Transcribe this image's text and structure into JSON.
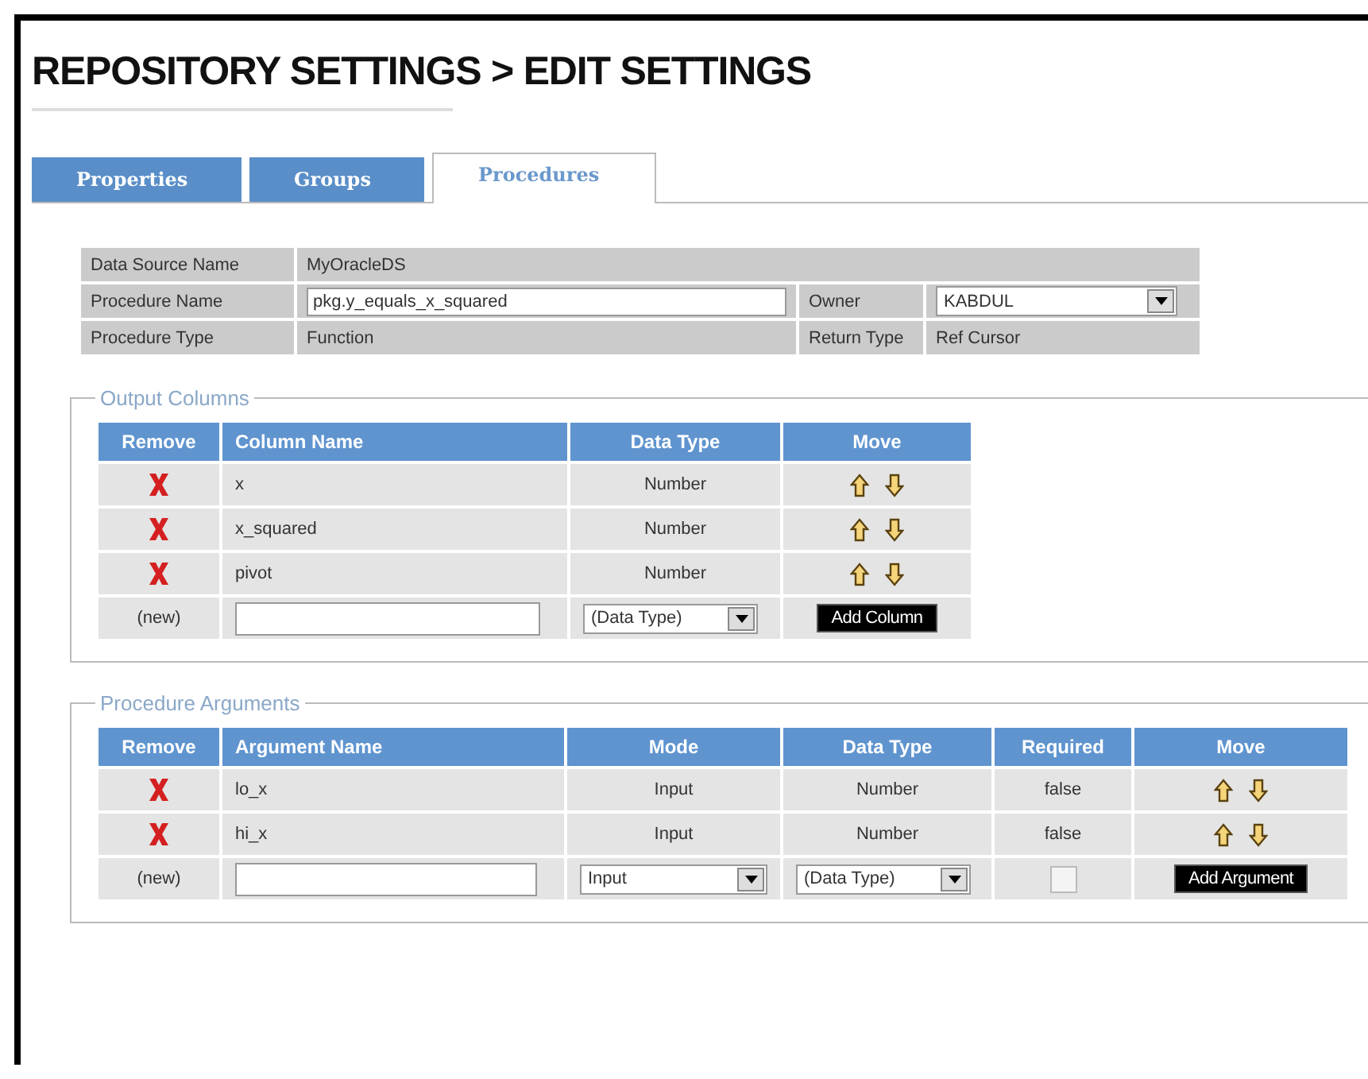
{
  "title": "REPOSITORY SETTINGS > EDIT SETTINGS",
  "tabs": [
    {
      "label": "Properties",
      "selected": false
    },
    {
      "label": "Groups",
      "selected": false
    },
    {
      "label": "Procedures",
      "selected": true
    }
  ],
  "info": [
    {
      "label": "Data Source Name",
      "value": "MyOracleDS",
      "kind": "text"
    },
    {
      "label": "Procedure Name",
      "value": "pkg.y_equals_x_squared",
      "kind": "input",
      "side": {
        "label": "Owner",
        "value": "KABDUL",
        "kind": "select"
      }
    },
    {
      "label": "Procedure Type",
      "value": "Function",
      "kind": "text",
      "side": {
        "label": "Return Type",
        "value": "Ref Cursor",
        "kind": "text"
      }
    }
  ],
  "output_columns": {
    "legend": "Output Columns",
    "columns": [
      "Remove",
      "Column Name",
      "Data Type",
      "Move"
    ],
    "rows": [
      {
        "name": "x",
        "data_type": "Number"
      },
      {
        "name": "x_squared",
        "data_type": "Number"
      },
      {
        "name": "pivot",
        "data_type": "Number"
      }
    ],
    "new_row": {
      "label": "(new)",
      "data_type": "(Data Type)",
      "button": "Add Column"
    }
  },
  "procedure_arguments": {
    "legend": "Procedure Arguments",
    "columns": [
      "Remove",
      "Argument Name",
      "Mode",
      "Data Type",
      "Required",
      "Move"
    ],
    "rows": [
      {
        "name": "lo_x",
        "mode": "Input",
        "data_type": "Number",
        "required": "false"
      },
      {
        "name": "hi_x",
        "mode": "Input",
        "data_type": "Number",
        "required": "false"
      }
    ],
    "new_row": {
      "label": "(new)",
      "mode": "Input",
      "data_type": "(Data Type)",
      "required_checked": false,
      "button": "Add Argument"
    }
  }
}
